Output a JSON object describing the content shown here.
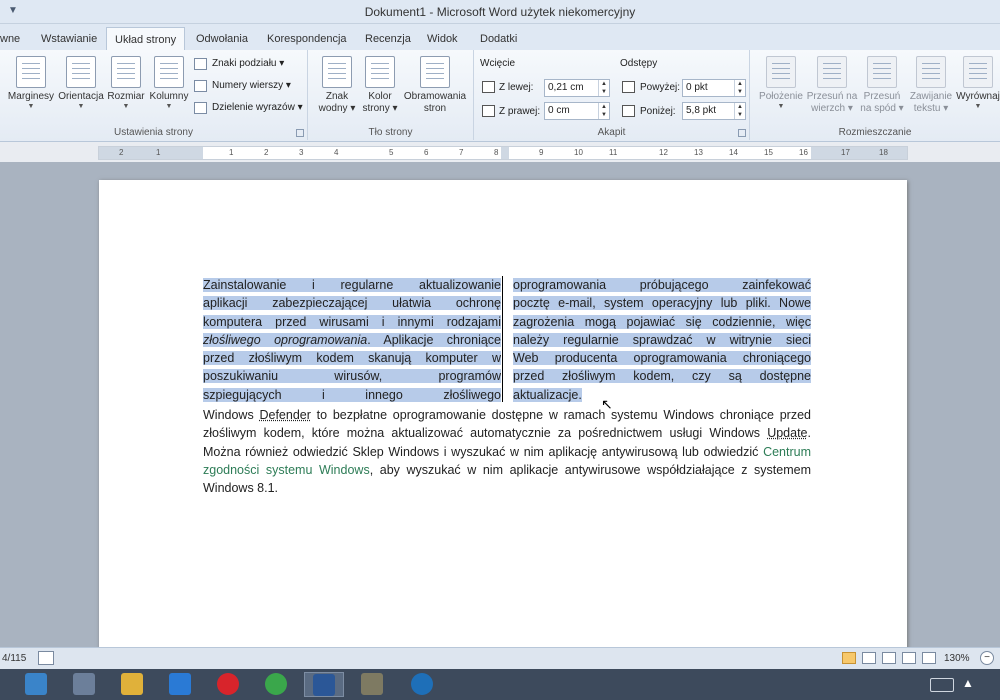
{
  "window": {
    "title": "Dokument1 - Microsoft Word użytek niekomercyjny"
  },
  "tabs": [
    {
      "label": "wne"
    },
    {
      "label": "Wstawianie"
    },
    {
      "label": "Układ strony"
    },
    {
      "label": "Odwołania"
    },
    {
      "label": "Korespondencja"
    },
    {
      "label": "Recenzja"
    },
    {
      "label": "Widok"
    },
    {
      "label": "Dodatki"
    }
  ],
  "active_tab": "Układ strony",
  "ribbon": {
    "ustawienia": {
      "label": "Ustawienia strony",
      "marginesy": "Marginesy",
      "orientacja": "Orientacja",
      "rozmiar": "Rozmiar",
      "kolumny": "Kolumny",
      "znaki_podzialu": "Znaki podziału",
      "numery_wierszy": "Numery wierszy",
      "dzielenie_wyrazow": "Dzielenie wyrazów"
    },
    "tlo": {
      "label": "Tło strony",
      "znak_wodny_1": "Znak",
      "znak_wodny_2": "wodny",
      "kolor_1": "Kolor",
      "kolor_2": "strony",
      "obramowania_1": "Obramowania",
      "obramowania_2": "stron"
    },
    "akapit": {
      "label": "Akapit",
      "wciecie": "Wcięcie",
      "z_lewej_label": "Z lewej:",
      "z_lewej_value": "0,21 cm",
      "z_prawej_label": "Z prawej:",
      "z_prawej_value": "0 cm",
      "odstepy": "Odstępy",
      "powyzej_label": "Powyżej:",
      "powyzej_value": "0 pkt",
      "ponizej_label": "Poniżej:",
      "ponizej_value": "5,8 pkt"
    },
    "rozmieszczanie": {
      "label": "Rozmieszczanie",
      "polozenie": "Położenie",
      "przesun_na_1": "Przesuń na",
      "przesun_na_2": "wierzch",
      "przesun_1": "Przesuń",
      "przesun_2": "na spód",
      "zawijanie_1": "Zawijanie",
      "zawijanie_2": "tekstu",
      "wyrownaj": "Wyrównaj"
    }
  },
  "ruler": {
    "numbers": [
      "2",
      "1",
      "1",
      "2",
      "3",
      "4",
      "5",
      "6",
      "7",
      "8",
      "9",
      "10",
      "11",
      "12",
      "13",
      "14",
      "15",
      "16",
      "17",
      "18"
    ]
  },
  "document": {
    "col1": {
      "lines": [
        "Zainstalowanie i regularne aktualizowanie",
        "aplikacji zabezpieczającej ułatwia ochronę",
        "komputera przed wirusami i innymi rodzajami"
      ],
      "italic": "złośliwego oprogramowania",
      "after_italic": ". Aplikacje chroniące",
      "lines2": [
        "przed złośliwym kodem skanują komputer w",
        "poszukiwaniu wirusów, programów",
        "szpiegujących i innego złośliwego"
      ]
    },
    "col2": {
      "lines": [
        "oprogramowania próbującego zainfekować",
        "pocztę e-mail, system operacyjny lub pliki. Nowe",
        "zagrożenia mogą pojawiać się codziennie, więc",
        "należy regularnie sprawdzać w witrynie sieci",
        "Web producenta oprogramowania chroniącego",
        "przed złośliwym kodem, czy są dostępne"
      ],
      "last": "aktualizacje."
    },
    "para2": {
      "t1": "Windows ",
      "defender": "Defender",
      "t2": " to bezpłatne oprogramowanie dostępne w ramach systemu Windows chroniące przed złośliwym kodem, które można aktualizować automatycznie za pośrednictwem usługi Windows ",
      "update": "Update",
      "t3": ". Można również odwiedzić Sklep Windows i wyszukać w nim aplikację antywirusową lub odwiedzić ",
      "link": "Centrum zgodności systemu Windows",
      "t4": ", aby wyszukać w nim aplikacje antywirusowe współdziałające z systemem Windows 8.1."
    }
  },
  "status": {
    "page_count": "4/115",
    "zoom": "130%"
  },
  "colors": {
    "selection": "#b7cbe9",
    "link": "#2d7c56",
    "ribbon": "#f6f9fc"
  }
}
